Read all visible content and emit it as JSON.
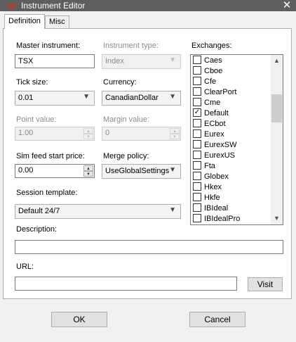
{
  "window": {
    "title": "Instrument Editor",
    "icon": "ninjatrader-logo-icon",
    "close_glyph": "✕",
    "accent": "#c0392b"
  },
  "tabs": [
    {
      "label": "Definition",
      "active": true
    },
    {
      "label": "Misc",
      "active": false
    }
  ],
  "form": {
    "master_instrument": {
      "label": "Master instrument:",
      "value": "TSX"
    },
    "instrument_type": {
      "label": "Instrument type:",
      "value": "Index",
      "disabled": true
    },
    "tick_size": {
      "label": "Tick size:",
      "value": "0.01"
    },
    "currency": {
      "label": "Currency:",
      "value": "CanadianDollar"
    },
    "point_value": {
      "label": "Point value:",
      "value": "1.00",
      "disabled": true
    },
    "margin_value": {
      "label": "Margin value:",
      "value": "0",
      "disabled": true
    },
    "sim_feed_start_price": {
      "label": "Sim feed start price:",
      "value": "0.00"
    },
    "merge_policy": {
      "label": "Merge policy:",
      "value": "UseGlobalSettings"
    },
    "session_template": {
      "label": "Session template:",
      "value": "Default 24/7"
    },
    "description": {
      "label": "Description:",
      "value": ""
    },
    "url": {
      "label": "URL:",
      "value": "",
      "visit_label": "Visit"
    }
  },
  "exchanges": {
    "label": "Exchanges:",
    "items": [
      {
        "name": "Caes",
        "checked": false
      },
      {
        "name": "Cboe",
        "checked": false
      },
      {
        "name": "Cfe",
        "checked": false
      },
      {
        "name": "ClearPort",
        "checked": false
      },
      {
        "name": "Cme",
        "checked": false
      },
      {
        "name": "Default",
        "checked": true
      },
      {
        "name": "ECbot",
        "checked": false
      },
      {
        "name": "Eurex",
        "checked": false
      },
      {
        "name": "EurexSW",
        "checked": false
      },
      {
        "name": "EurexUS",
        "checked": false
      },
      {
        "name": "Fta",
        "checked": false
      },
      {
        "name": "Globex",
        "checked": false
      },
      {
        "name": "Hkex",
        "checked": false
      },
      {
        "name": "Hkfe",
        "checked": false
      },
      {
        "name": "IBIdeal",
        "checked": false
      },
      {
        "name": "IBIdealPro",
        "checked": false
      }
    ]
  },
  "buttons": {
    "ok": "OK",
    "cancel": "Cancel"
  },
  "glyphs": {
    "check": "✓",
    "dropdown": "▼",
    "spin_up": "▲",
    "spin_down": "▼",
    "scroll_up": "▲",
    "scroll_down": "▼"
  }
}
